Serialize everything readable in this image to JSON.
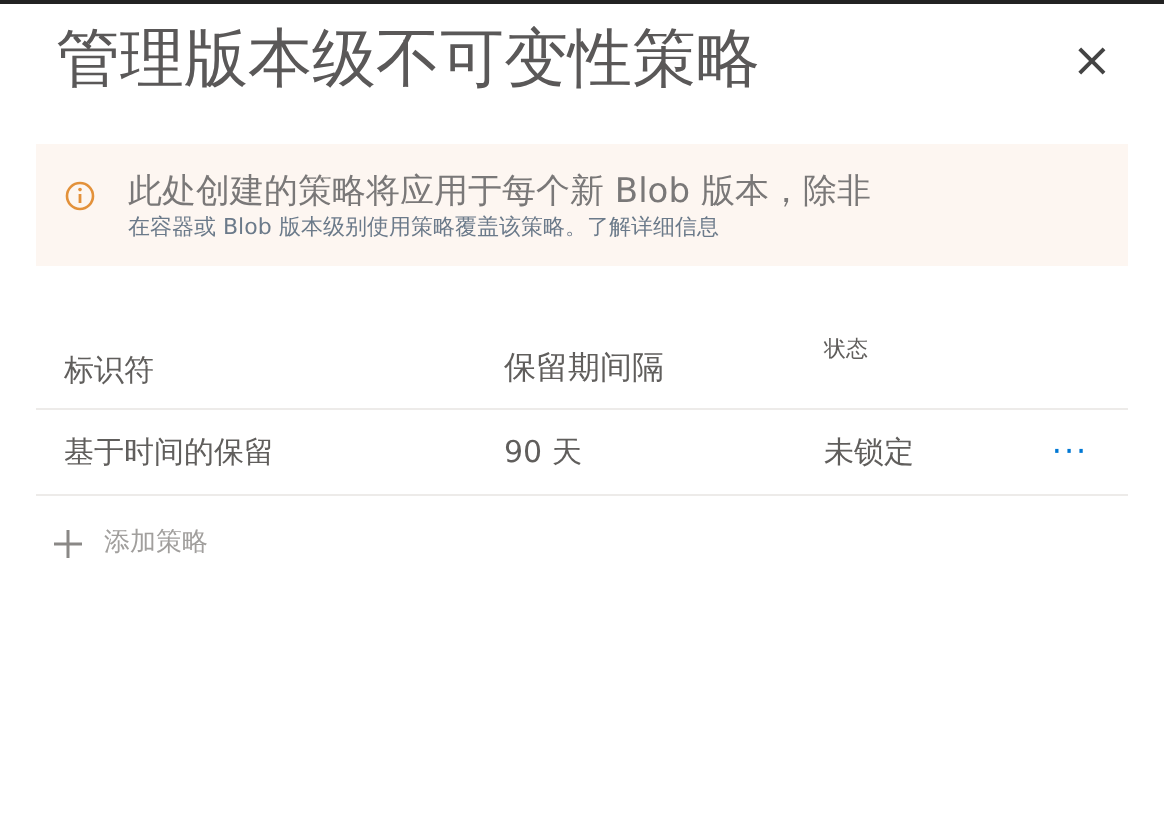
{
  "panel": {
    "title": "管理版本级不可变性策略",
    "close": "×"
  },
  "notice": {
    "text": "此处创建的策略将应用于每个新 Blob 版本，除非",
    "detail": "在容器或 Blob 版本级别使用策略覆盖该策略。",
    "link": "了解详细信息"
  },
  "table": {
    "columns": [
      "标识符",
      "保留期间隔",
      "状态"
    ],
    "rows": [
      {
        "identifier": "基于时间的保留",
        "interval": "90 天",
        "status": "未锁定",
        "menu": "···"
      }
    ]
  },
  "add_button": {
    "label": "添加策略"
  }
}
